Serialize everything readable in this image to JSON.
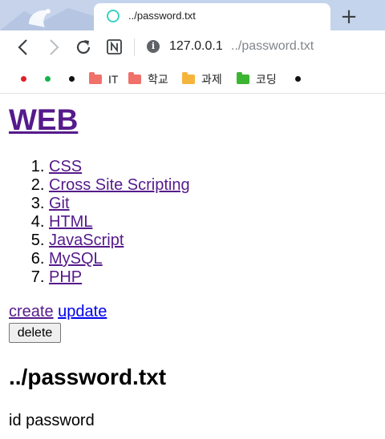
{
  "browser": {
    "tab": {
      "title": "../password.txt"
    },
    "new_tab_label": "+",
    "address": {
      "host": "127.0.0.1",
      "path": "../password.txt"
    },
    "bookmarks": [
      {
        "type": "dot",
        "color": "#e0202a"
      },
      {
        "type": "dot",
        "color": "#12b34b"
      },
      {
        "type": "dot",
        "color": "#111111"
      },
      {
        "type": "folder",
        "label": "IT",
        "color": "#f0706a"
      },
      {
        "type": "folder",
        "label": "학교",
        "color": "#f0706a"
      },
      {
        "type": "folder",
        "label": "과제",
        "color": "#f5b53c"
      },
      {
        "type": "folder",
        "label": "코딩",
        "color": "#3cb531"
      },
      {
        "type": "dot",
        "color": "#111111"
      }
    ],
    "icons": [
      "back-icon",
      "forward-icon",
      "reload-icon",
      "notion-icon",
      "info-icon"
    ]
  },
  "page": {
    "heading": "WEB",
    "topics": [
      "CSS",
      "Cross Site Scripting",
      "Git",
      "HTML",
      "JavaScript",
      "MySQL",
      "PHP"
    ],
    "create_label": "create",
    "update_label": "update",
    "delete_label": "delete",
    "title": "../password.txt",
    "description": "id password"
  }
}
